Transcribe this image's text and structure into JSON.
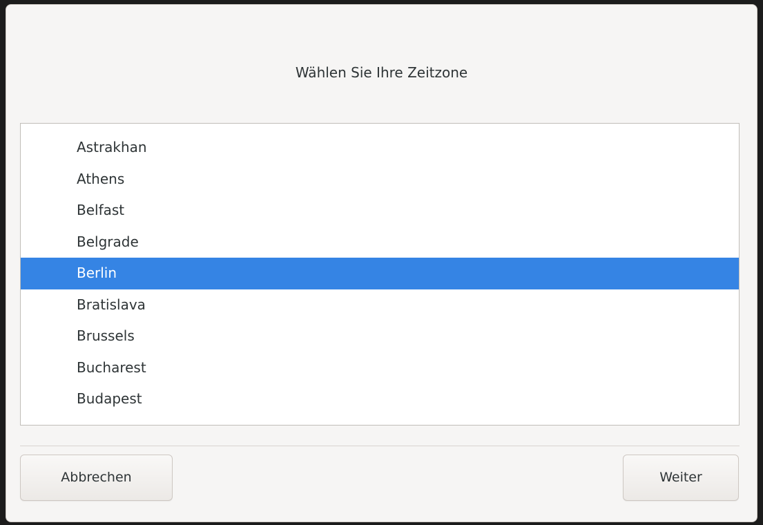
{
  "dialog": {
    "title": "Wählen Sie Ihre Zeitzone"
  },
  "timezone_list": {
    "items": [
      {
        "label": "Astrakhan",
        "selected": false
      },
      {
        "label": "Athens",
        "selected": false
      },
      {
        "label": "Belfast",
        "selected": false
      },
      {
        "label": "Belgrade",
        "selected": false
      },
      {
        "label": "Berlin",
        "selected": true
      },
      {
        "label": "Bratislava",
        "selected": false
      },
      {
        "label": "Brussels",
        "selected": false
      },
      {
        "label": "Bucharest",
        "selected": false
      },
      {
        "label": "Budapest",
        "selected": false
      }
    ],
    "selected_color": "#3584e4"
  },
  "buttons": {
    "cancel_label": "Abbrechen",
    "next_label": "Weiter"
  }
}
